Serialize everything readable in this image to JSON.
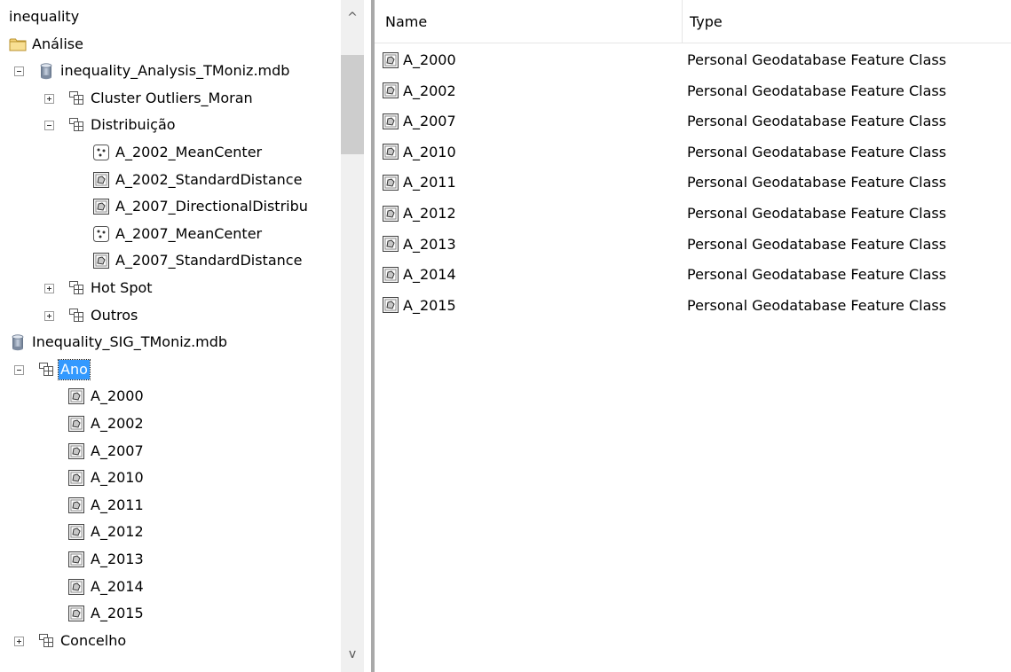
{
  "tree": {
    "nodes": [
      {
        "label": "inequality",
        "icon": "none",
        "expander": "none",
        "depth": 0
      },
      {
        "label": "Análise",
        "icon": "folder-icon",
        "expander": "none",
        "depth": 0
      },
      {
        "label": "inequality_Analysis_TMoniz.mdb",
        "icon": "database-icon",
        "expander": "minus",
        "depth": 1
      },
      {
        "label": "Cluster Outliers_Moran",
        "icon": "feature-dataset-icon",
        "expander": "plus",
        "depth": 2
      },
      {
        "label": "Distribuição",
        "icon": "feature-dataset-icon",
        "expander": "minus",
        "depth": 2
      },
      {
        "label": "A_2002_MeanCenter",
        "icon": "point-feature-class-icon",
        "expander": "none",
        "depth": 3
      },
      {
        "label": "A_2002_StandardDistance",
        "icon": "polygon-feature-class-icon",
        "expander": "none",
        "depth": 3
      },
      {
        "label": "A_2007_DirectionalDistribu",
        "icon": "polygon-feature-class-icon",
        "expander": "none",
        "depth": 3
      },
      {
        "label": "A_2007_MeanCenter",
        "icon": "point-feature-class-icon",
        "expander": "none",
        "depth": 3
      },
      {
        "label": "A_2007_StandardDistance",
        "icon": "polygon-feature-class-icon",
        "expander": "none",
        "depth": 3
      },
      {
        "label": "Hot Spot",
        "icon": "feature-dataset-icon",
        "expander": "plus",
        "depth": 2
      },
      {
        "label": "Outros",
        "icon": "feature-dataset-icon",
        "expander": "plus",
        "depth": 2
      },
      {
        "label": "Inequality_SIG_TMoniz.mdb",
        "icon": "database-icon",
        "expander": "none",
        "depth": 0
      },
      {
        "label": "Ano",
        "icon": "feature-dataset-icon",
        "expander": "minus",
        "depth": 1,
        "selected": true
      },
      {
        "label": "A_2000",
        "icon": "polygon-feature-class-icon",
        "expander": "none",
        "depth": 2
      },
      {
        "label": "A_2002",
        "icon": "polygon-feature-class-icon",
        "expander": "none",
        "depth": 2
      },
      {
        "label": "A_2007",
        "icon": "polygon-feature-class-icon",
        "expander": "none",
        "depth": 2
      },
      {
        "label": "A_2010",
        "icon": "polygon-feature-class-icon",
        "expander": "none",
        "depth": 2
      },
      {
        "label": "A_2011",
        "icon": "polygon-feature-class-icon",
        "expander": "none",
        "depth": 2
      },
      {
        "label": "A_2012",
        "icon": "polygon-feature-class-icon",
        "expander": "none",
        "depth": 2
      },
      {
        "label": "A_2013",
        "icon": "polygon-feature-class-icon",
        "expander": "none",
        "depth": 2
      },
      {
        "label": "A_2014",
        "icon": "polygon-feature-class-icon",
        "expander": "none",
        "depth": 2
      },
      {
        "label": "A_2015",
        "icon": "polygon-feature-class-icon",
        "expander": "none",
        "depth": 2
      },
      {
        "label": "Concelho",
        "icon": "feature-dataset-icon",
        "expander": "plus",
        "depth": 1
      }
    ]
  },
  "scrollbar": {
    "up_icon": "^",
    "down_icon": "v"
  },
  "list": {
    "columns": {
      "name": "Name",
      "type": "Type"
    },
    "rows": [
      {
        "name": "A_2000",
        "type": "Personal Geodatabase Feature Class",
        "icon": "polygon-feature-class-icon"
      },
      {
        "name": "A_2002",
        "type": "Personal Geodatabase Feature Class",
        "icon": "polygon-feature-class-icon"
      },
      {
        "name": "A_2007",
        "type": "Personal Geodatabase Feature Class",
        "icon": "polygon-feature-class-icon"
      },
      {
        "name": "A_2010",
        "type": "Personal Geodatabase Feature Class",
        "icon": "polygon-feature-class-icon"
      },
      {
        "name": "A_2011",
        "type": "Personal Geodatabase Feature Class",
        "icon": "polygon-feature-class-icon"
      },
      {
        "name": "A_2012",
        "type": "Personal Geodatabase Feature Class",
        "icon": "polygon-feature-class-icon"
      },
      {
        "name": "A_2013",
        "type": "Personal Geodatabase Feature Class",
        "icon": "polygon-feature-class-icon"
      },
      {
        "name": "A_2014",
        "type": "Personal Geodatabase Feature Class",
        "icon": "polygon-feature-class-icon"
      },
      {
        "name": "A_2015",
        "type": "Personal Geodatabase Feature Class",
        "icon": "polygon-feature-class-icon"
      }
    ]
  },
  "colors": {
    "selection": "#3399ff",
    "scroll_thumb": "#cdcdcd",
    "scroll_track": "#f0f0f0",
    "splitter": "#a9a9a9"
  }
}
